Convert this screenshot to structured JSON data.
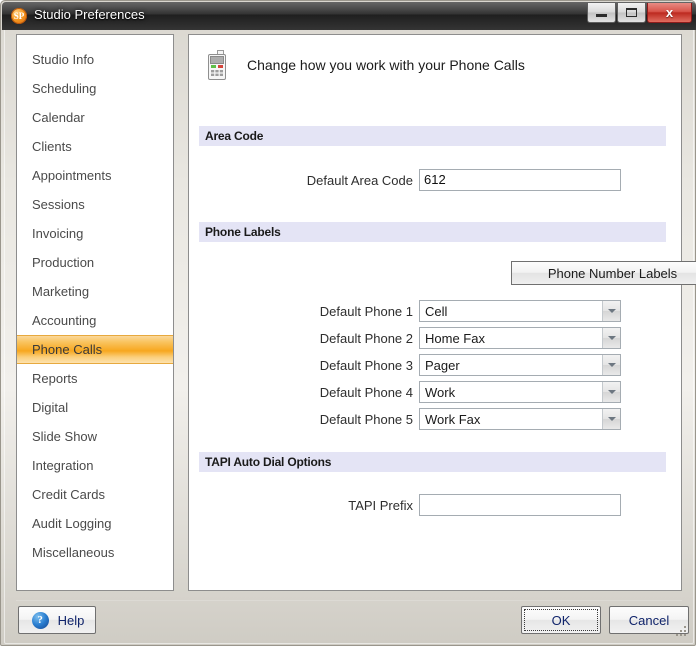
{
  "window": {
    "title": "Studio Preferences",
    "app_icon": "studio-preferences-logo",
    "minimize_label": "Minimize",
    "maximize_label": "Maximize",
    "close_label": "Close",
    "close_glyph": "x"
  },
  "sidebar": {
    "items": [
      {
        "label": "Studio Info",
        "selected": false
      },
      {
        "label": "Scheduling",
        "selected": false
      },
      {
        "label": "Calendar",
        "selected": false
      },
      {
        "label": "Clients",
        "selected": false
      },
      {
        "label": "Appointments",
        "selected": false
      },
      {
        "label": "Sessions",
        "selected": false
      },
      {
        "label": "Invoicing",
        "selected": false
      },
      {
        "label": "Production",
        "selected": false
      },
      {
        "label": "Marketing",
        "selected": false
      },
      {
        "label": "Accounting",
        "selected": false
      },
      {
        "label": "Phone Calls",
        "selected": true
      },
      {
        "label": "Reports",
        "selected": false
      },
      {
        "label": "Digital",
        "selected": false
      },
      {
        "label": "Slide Show",
        "selected": false
      },
      {
        "label": "Integration",
        "selected": false
      },
      {
        "label": "Credit Cards",
        "selected": false
      },
      {
        "label": "Audit Logging",
        "selected": false
      },
      {
        "label": "Miscellaneous",
        "selected": false
      }
    ]
  },
  "content": {
    "page_icon": "mobile-phone-icon",
    "page_title": "Change how you work with your Phone Calls",
    "sections": {
      "area_code": {
        "heading": "Area Code",
        "default_area_code_label": "Default Area Code",
        "default_area_code_value": "612"
      },
      "phone_labels": {
        "heading": "Phone Labels",
        "phone_number_labels_button": "Phone Number Labels",
        "rows": [
          {
            "label": "Default Phone 1",
            "value": "Cell"
          },
          {
            "label": "Default Phone 2",
            "value": "Home Fax"
          },
          {
            "label": "Default Phone 3",
            "value": "Pager"
          },
          {
            "label": "Default Phone 4",
            "value": "Work"
          },
          {
            "label": "Default Phone 5",
            "value": "Work Fax"
          }
        ]
      },
      "tapi": {
        "heading": "TAPI Auto Dial Options",
        "prefix_label": "TAPI Prefix",
        "prefix_value": ""
      }
    }
  },
  "footer": {
    "help_label": "Help",
    "help_icon_glyph": "?",
    "ok_label": "OK",
    "cancel_label": "Cancel"
  },
  "colors": {
    "selected_nav_accent": "#f7a71f",
    "section_header_bg": "#e4e4f5",
    "close_button_red": "#bd2a20",
    "button_text_blue": "#10246b"
  }
}
